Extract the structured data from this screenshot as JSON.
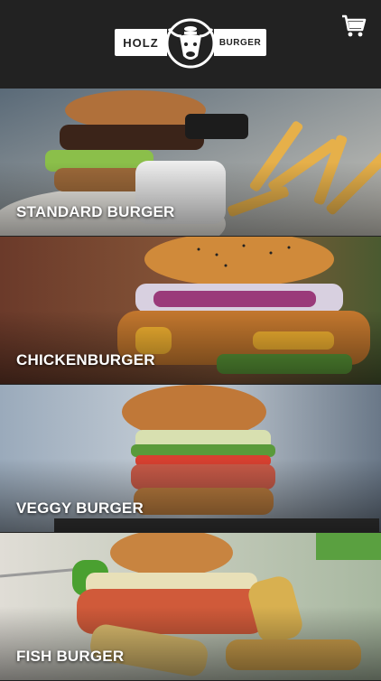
{
  "header": {
    "logo": {
      "left_text": "HOLZ",
      "right_text": "BURGER"
    },
    "cart_icon": "shopping-cart-icon"
  },
  "categories": [
    {
      "label": "STANDARD BURGER"
    },
    {
      "label": "CHICKENBURGER"
    },
    {
      "label": "VEGGY BURGER"
    },
    {
      "label": "FISH BURGER"
    }
  ]
}
